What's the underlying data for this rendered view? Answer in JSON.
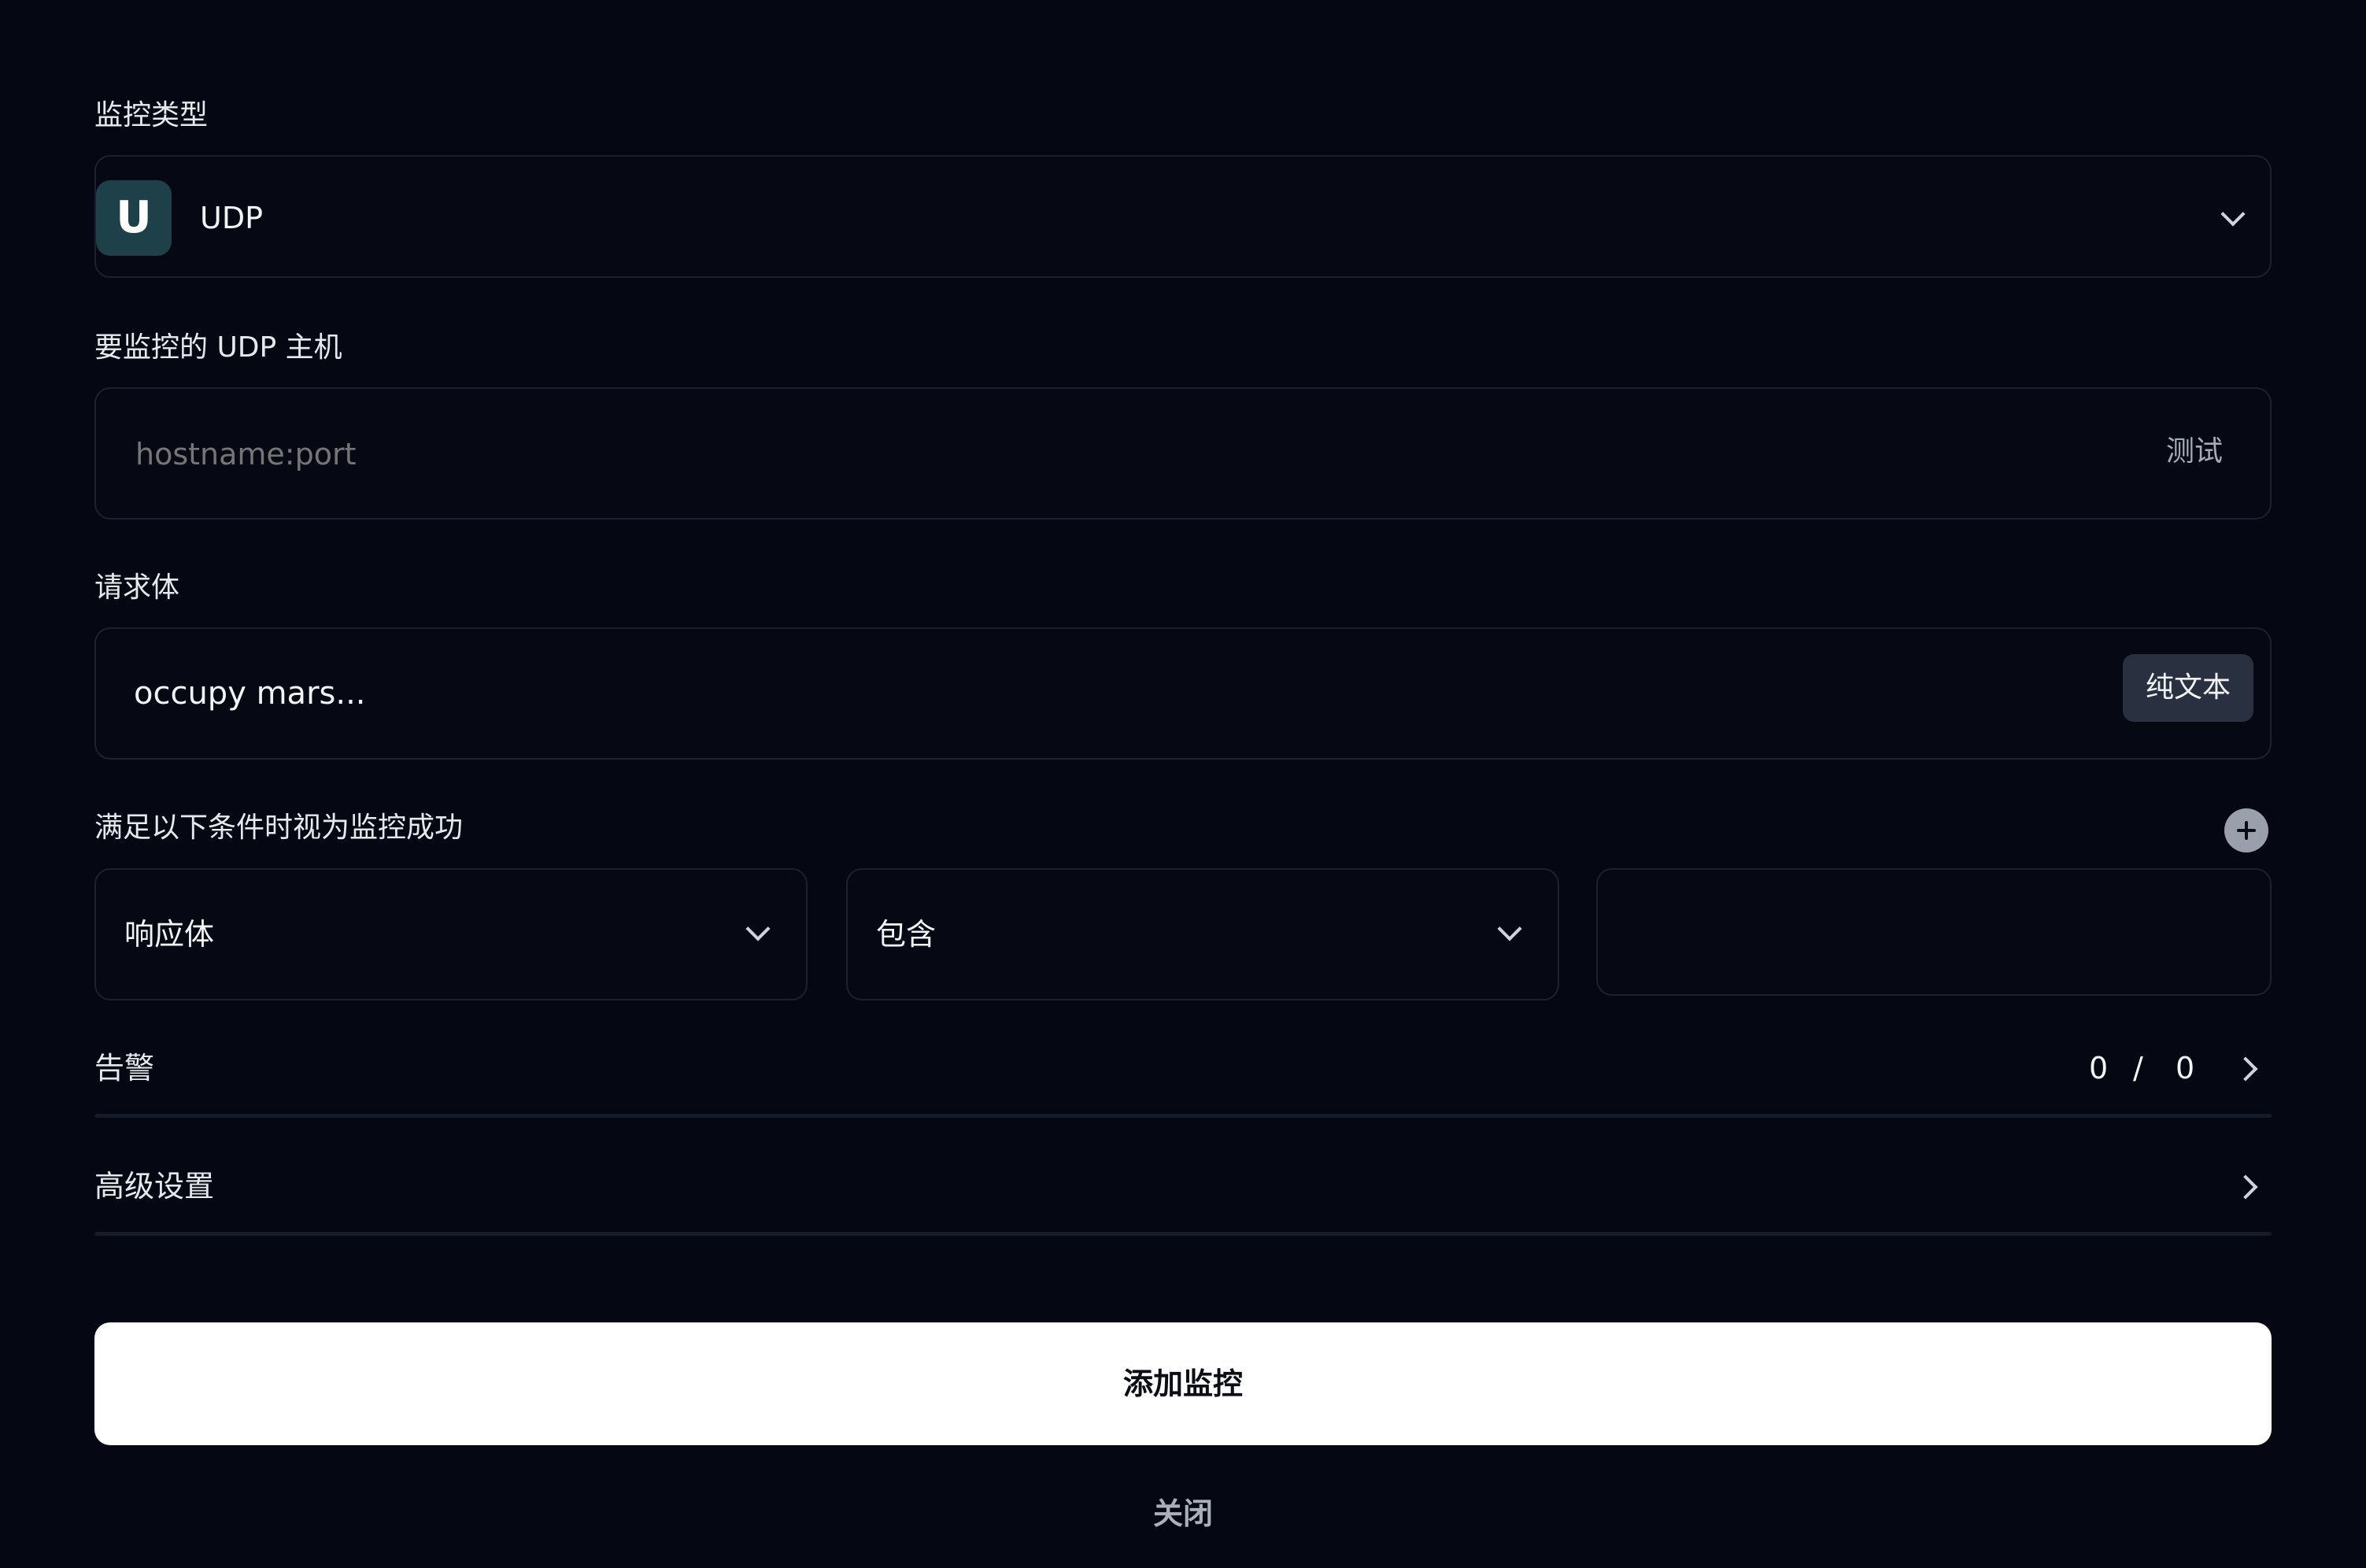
{
  "monitor_type": {
    "label": "监控类型",
    "badge_letter": "U",
    "value": "UDP",
    "badge_color": "#1d4049"
  },
  "host": {
    "label": "要监控的 UDP 主机",
    "placeholder": "hostname:port",
    "test_label": "测试"
  },
  "request_body": {
    "label": "请求体",
    "value": "occupy mars...",
    "format_label": "纯文本"
  },
  "conditions": {
    "label": "满足以下条件时视为监控成功",
    "field_value": "响应体",
    "operator_value": "包含",
    "target_value": ""
  },
  "alerts": {
    "label": "告警",
    "count_left": "0",
    "separator": "/",
    "count_right": "0"
  },
  "advanced": {
    "label": "高级设置"
  },
  "actions": {
    "submit_label": "添加监控",
    "close_label": "关闭"
  }
}
